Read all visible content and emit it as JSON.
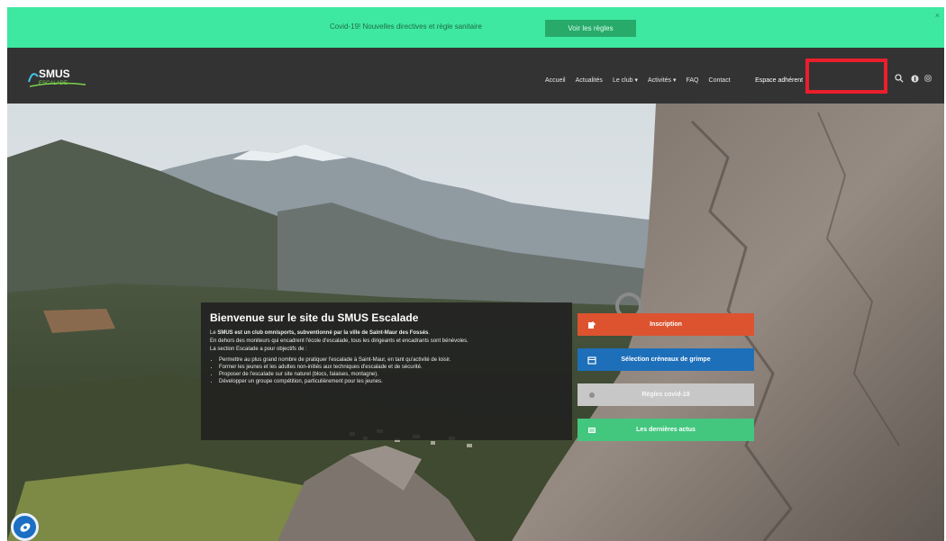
{
  "banner": {
    "text": "Covid-19! Nouvelles directives et règle sanitaire",
    "button": "Voir les règles",
    "close": "×"
  },
  "brand": {
    "logo_text_top": "SMUS",
    "logo_text_bottom": "ESCALADE"
  },
  "nav": {
    "items": [
      "Accueil",
      "Actualités",
      "Le club ▾",
      "Activités ▾",
      "FAQ",
      "Contact"
    ],
    "member": "Espace adhérent",
    "icons": [
      "search-icon",
      "facebook-icon",
      "instagram-icon"
    ]
  },
  "welcome": {
    "title": "Bienvenue sur le site du SMUS Escalade",
    "intro_prefix": "Le ",
    "intro_bold": "SMUS est un club omnisports, subventionné par la ville de Saint-Maur des Fossés",
    "intro_suffix": ".",
    "p2": "En dehors des moniteurs qui encadrent l'école d'escalade, tous les dirigeants et encadrants sont bénévoles.",
    "p3": "La section Escalade a pour objectifs de :",
    "bullets": [
      "Permettre au plus grand nombre de pratiquer l'escalade à Saint-Maur, en tant qu'activité de loisir.",
      "Former les jeunes et les adultes non-initiés aux techniques d'escalade et de sécurité.",
      "Proposer de l'escalade sur site naturel (blocs, falaises, montagne).",
      "Développer un groupe compétition, particulièrement pour les jeunes."
    ]
  },
  "cta": [
    {
      "label": "Inscription",
      "color": "#dd5330",
      "icon": "edit-icon"
    },
    {
      "label": "Sélection créneaux de grimpe",
      "color": "#1d6fba",
      "icon": "calendar-icon"
    },
    {
      "label": "Règles covid-19",
      "color": "#c7c7c7",
      "icon": "virus-icon"
    },
    {
      "label": "Les dernières actus",
      "color": "#43c77f",
      "icon": "news-icon"
    }
  ],
  "colors": {
    "banner": "#3ee8a0",
    "nav": "#333334",
    "highlight": "#ea1f2b"
  }
}
